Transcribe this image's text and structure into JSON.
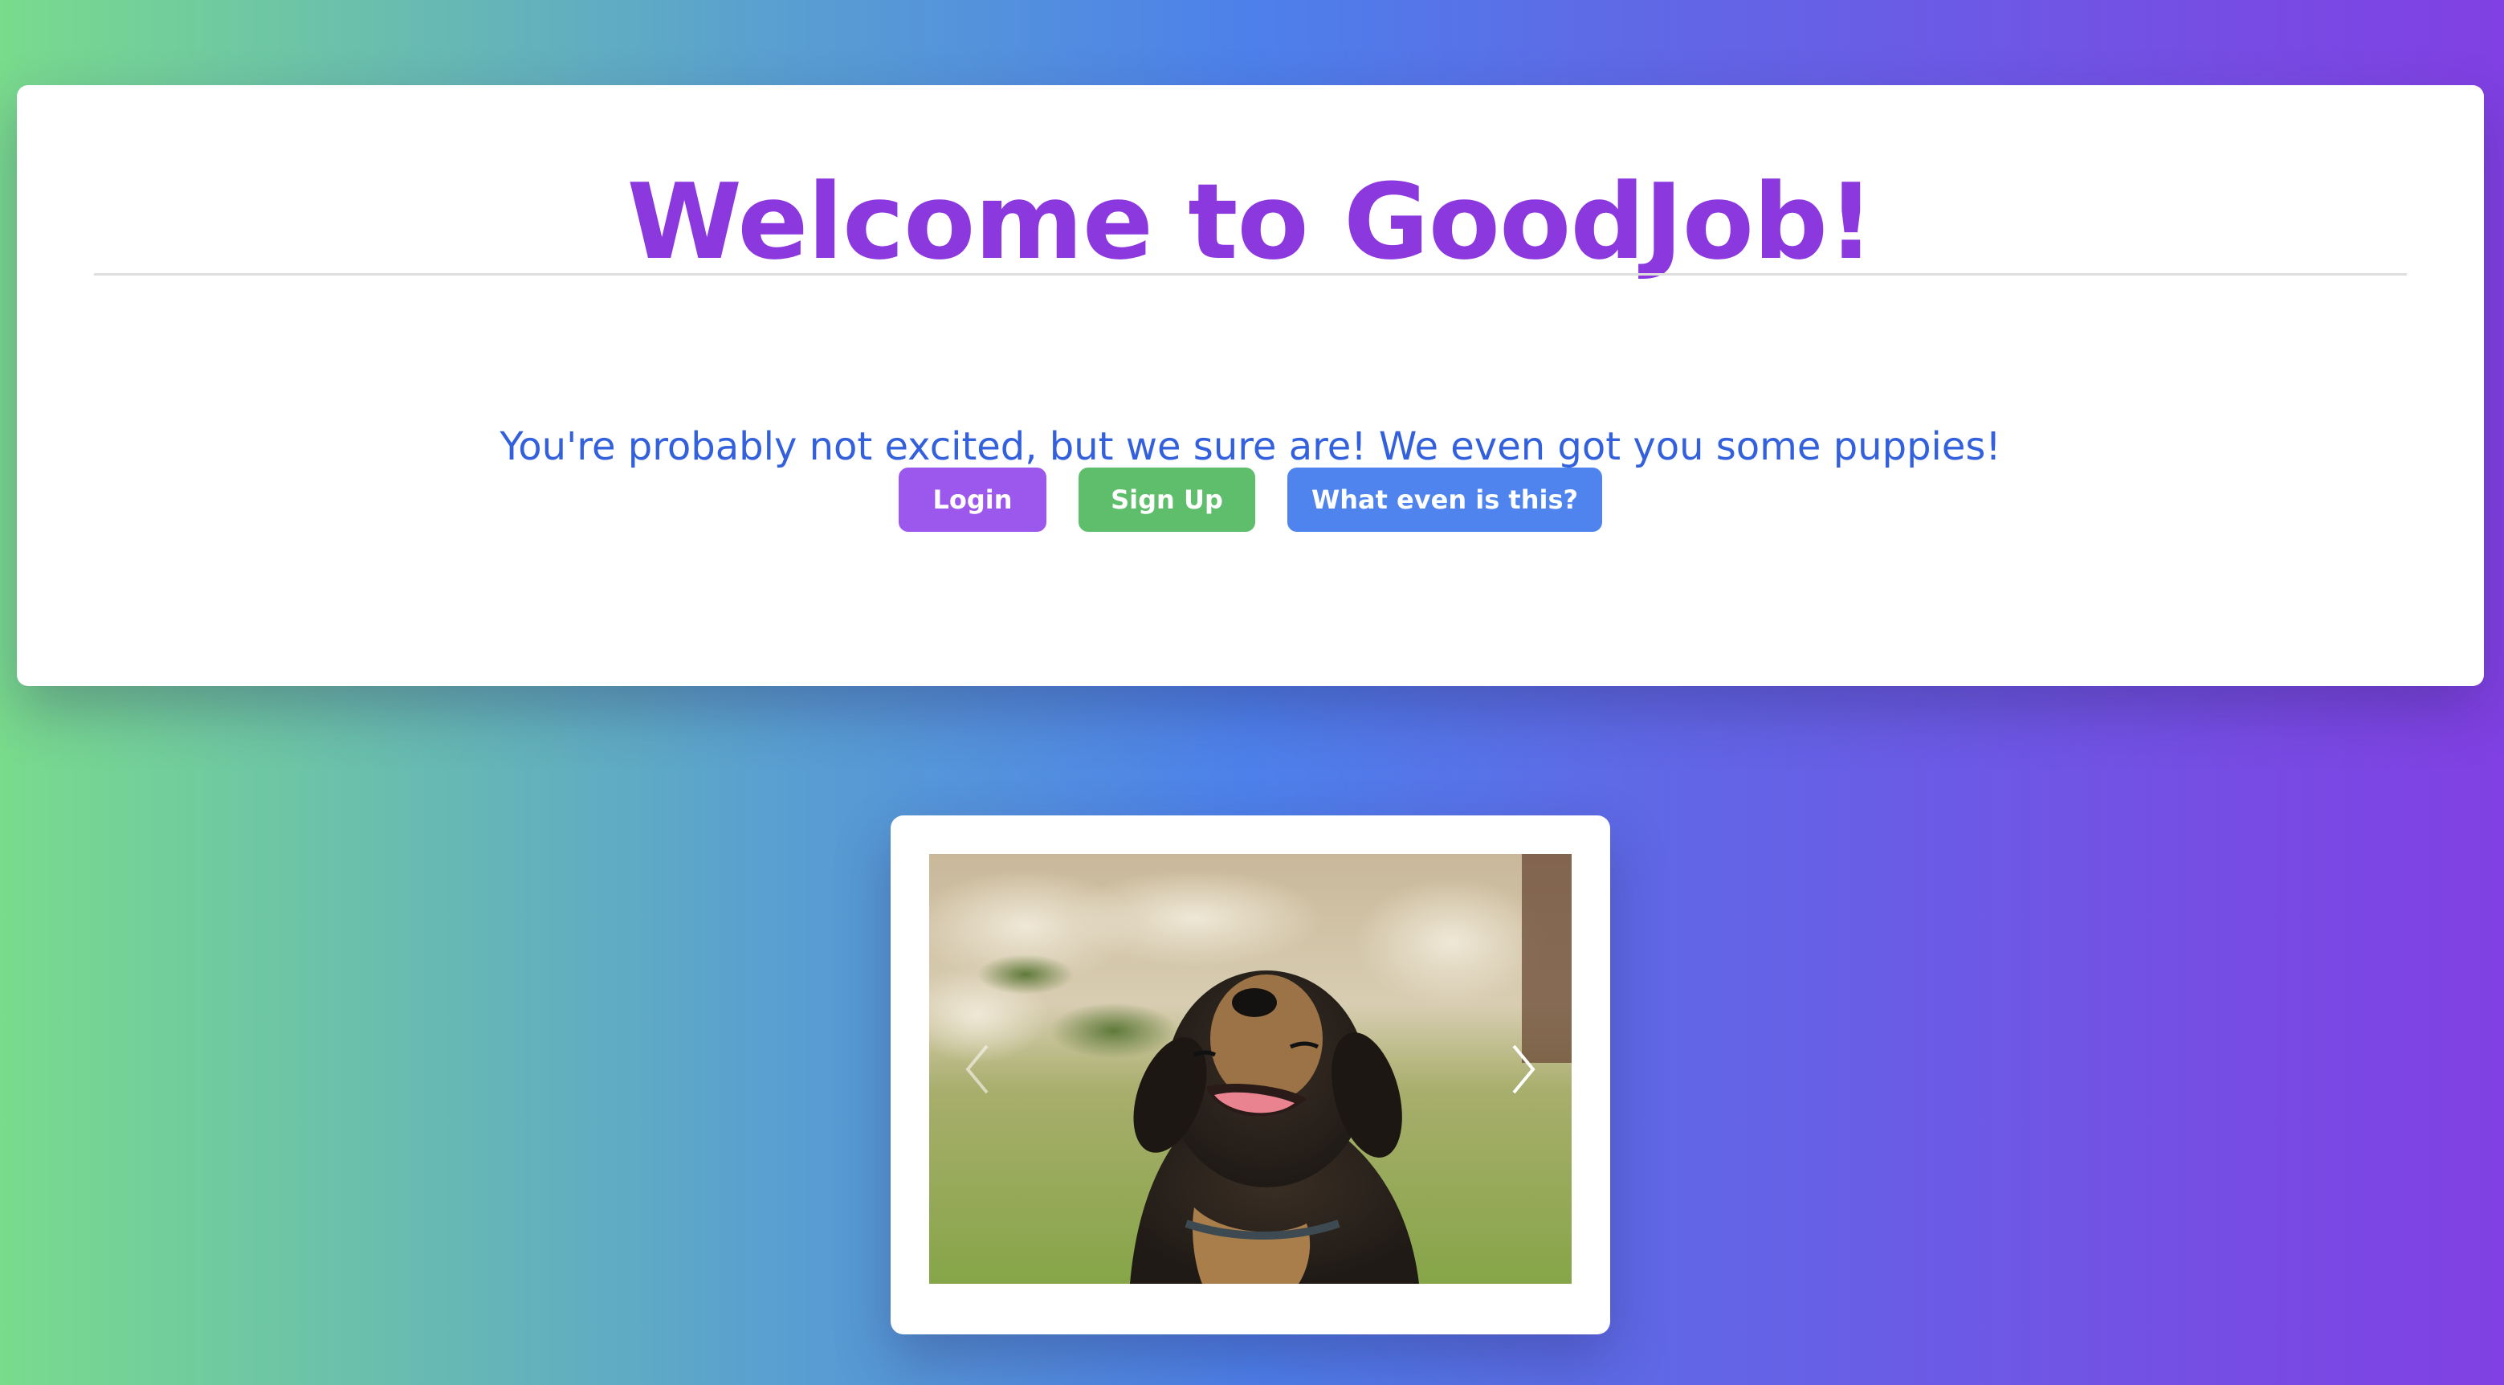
{
  "hero": {
    "title": "Welcome to GoodJob!",
    "subtitle": "You're probably not excited, but we sure are! We even got you some puppies!",
    "buttons": {
      "login": "Login",
      "signup": "Sign Up",
      "about": "What even is this?"
    }
  },
  "carousel": {
    "image_icon": "puppy-photo",
    "prev_icon": "chevron-left-icon",
    "next_icon": "chevron-right-icon"
  },
  "colors": {
    "title": "#8c38df",
    "subtitle": "#3361dd",
    "login": "#9c58ec",
    "signup": "#5fbe6b",
    "about": "#4f84ee"
  }
}
